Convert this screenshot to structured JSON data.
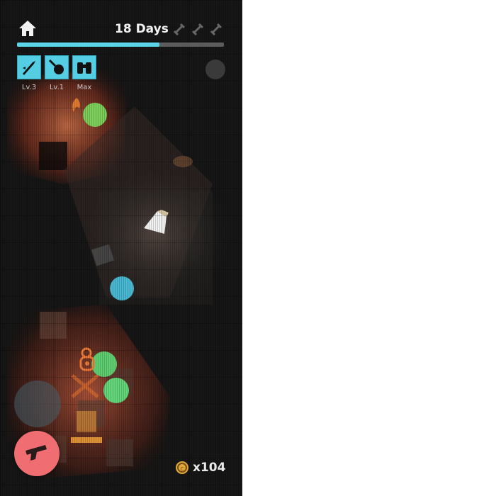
{
  "hud": {
    "days_label": "18 Days",
    "days_progress": 0.69,
    "skull_count": 3,
    "coins_prefix": "x",
    "coins_value": "104",
    "items": [
      {
        "icon": "rocket-launcher-icon",
        "level": "Lv.3"
      },
      {
        "icon": "frying-pan-icon",
        "level": "Lv.1"
      },
      {
        "icon": "binoculars-icon",
        "level": "Max"
      }
    ]
  },
  "colors": {
    "accent": "#55cde3",
    "fire_button": "#f06d72",
    "enemy_green": "#6fd36a",
    "enemy_cyan": "#49b8d2",
    "flashlight_warm": "#b5523c",
    "player": "#f07a38"
  },
  "controls": {
    "fire_icon": "pistol-icon",
    "joystick_icon": "joystick"
  }
}
